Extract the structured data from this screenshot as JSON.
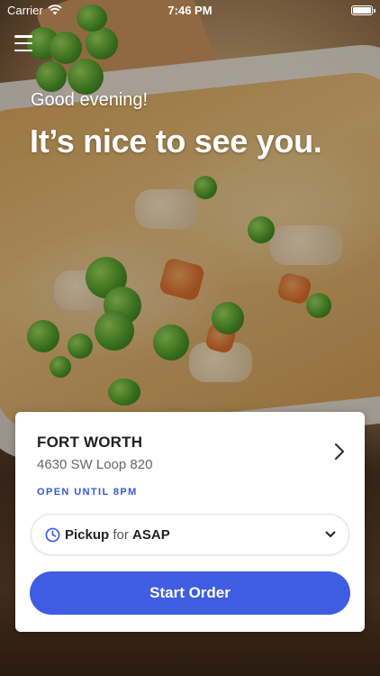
{
  "status_bar": {
    "carrier": "Carrier",
    "time": "7:46 PM",
    "wifi_icon": "wifi-icon",
    "battery_icon": "battery-icon"
  },
  "menu": {
    "icon": "hamburger-menu-icon"
  },
  "hero": {
    "greeting": "Good evening!",
    "headline": "It’s nice to see you."
  },
  "location_card": {
    "name": "FORT WORTH",
    "address": "4630 SW Loop 820",
    "hours": "OPEN UNTIL 8PM",
    "chevron_icon": "chevron-right-icon",
    "order_type": {
      "mode": "Pickup",
      "connector": "for",
      "time": "ASAP",
      "icon": "clock-icon",
      "dropdown_icon": "chevron-down-icon"
    },
    "cta_label": "Start Order"
  },
  "colors": {
    "accent": "#3f5de1",
    "hours_text": "#3858d6",
    "card_bg": "#ffffff"
  }
}
